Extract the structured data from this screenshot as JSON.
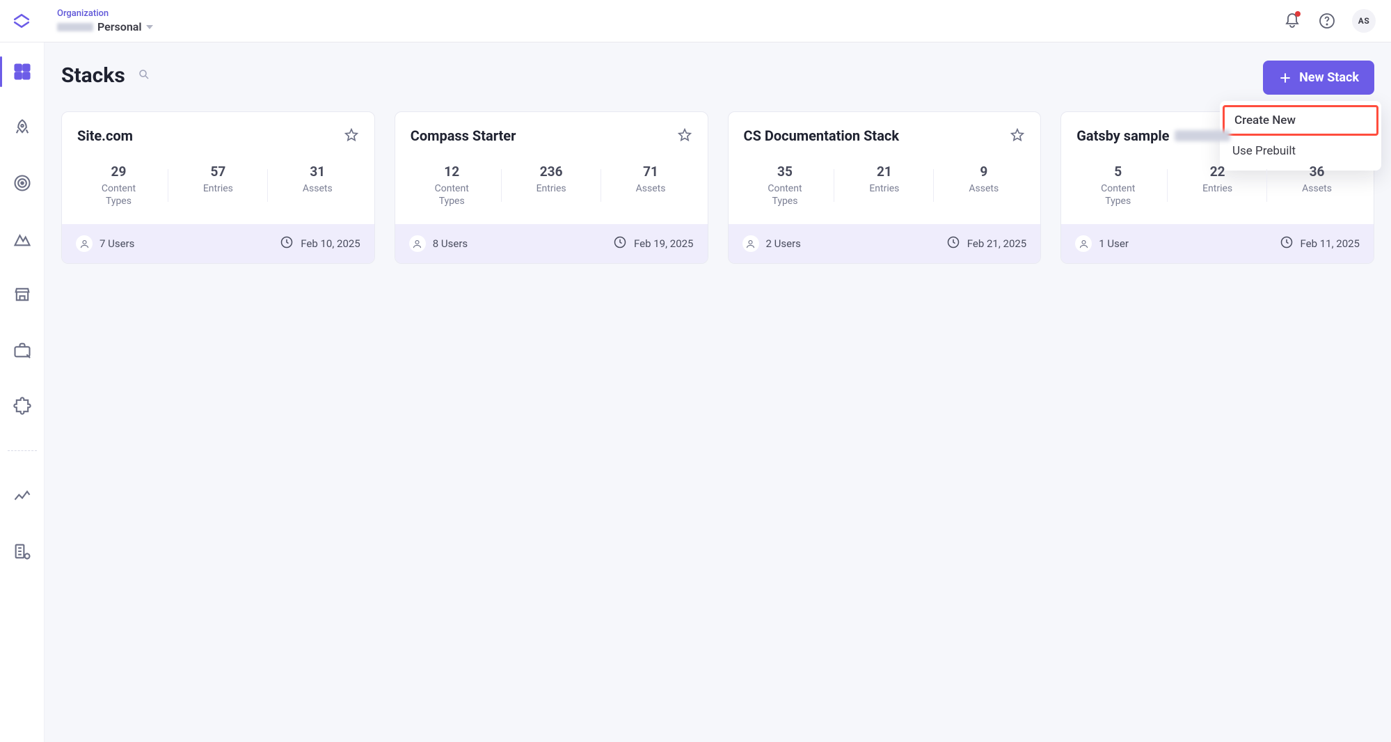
{
  "header": {
    "org_label": "Organization",
    "org_name": "Personal",
    "avatar_initials": "AS"
  },
  "page": {
    "title": "Stacks",
    "new_stack_label": "New Stack"
  },
  "dropdown": {
    "create_new": "Create New",
    "use_prebuilt": "Use Prebuilt"
  },
  "labels": {
    "content_types": "Content\nTypes",
    "entries": "Entries",
    "assets": "Assets"
  },
  "cards": [
    {
      "title": "Site.com",
      "has_blur_suffix": false,
      "content_types": 29,
      "entries": 57,
      "assets": 31,
      "users_text": "7 Users",
      "date": "Feb 10, 2025"
    },
    {
      "title": "Compass Starter",
      "has_blur_suffix": false,
      "content_types": 12,
      "entries": 236,
      "assets": 71,
      "users_text": "8 Users",
      "date": "Feb 19, 2025"
    },
    {
      "title": "CS Documentation Stack",
      "has_blur_suffix": false,
      "content_types": 35,
      "entries": 21,
      "assets": 9,
      "users_text": "2 Users",
      "date": "Feb 21, 2025"
    },
    {
      "title": "Gatsby sample",
      "has_blur_suffix": true,
      "content_types": 5,
      "entries": 22,
      "assets": 36,
      "users_text": "1 User",
      "date": "Feb 11, 2025"
    }
  ]
}
